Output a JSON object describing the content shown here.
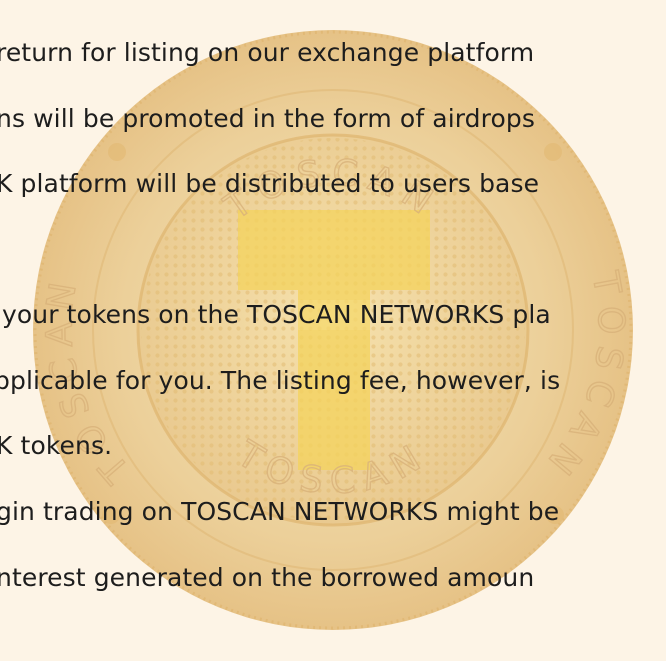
{
  "document": {
    "lines": [
      "return for listing on our exchange platform",
      "ns will be promoted in the form of airdrops",
      "K platform will be distributed to users base",
      " your tokens on the TOSCAN NETWORKS pla",
      "pplicable for you. The listing fee, however, is",
      "K tokens.",
      "gin trading on TOSCAN NETWORKS might be",
      "nterest generated on the borrowed amoun"
    ]
  },
  "watermark": {
    "brand_text": "TOSCAN",
    "colors": {
      "outer_ring": "#e9c98d",
      "inner_disc": "#f2d9a4",
      "logo": "#f4d35c",
      "text": "#1d1d1d",
      "background": "#fdf4e6"
    }
  }
}
